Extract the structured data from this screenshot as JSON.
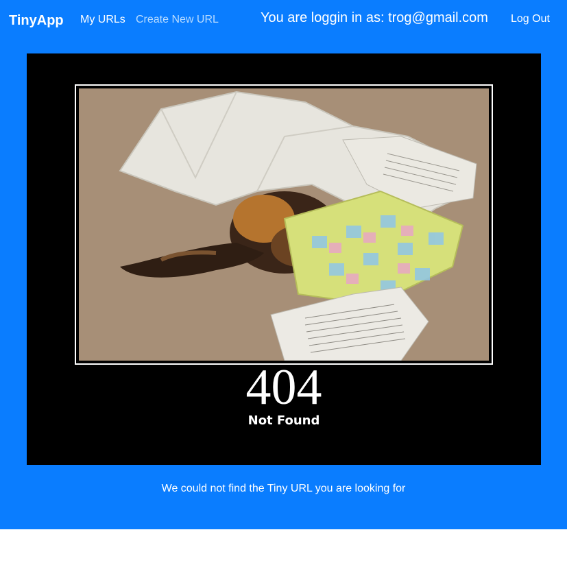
{
  "navbar": {
    "brand": "TinyApp",
    "links": [
      {
        "label": "My URLs"
      },
      {
        "label": "Create New URL"
      }
    ],
    "login_status": "You are loggin in as: trog@gmail.com",
    "logout_label": "Log Out"
  },
  "error": {
    "code": "404",
    "title": "Not Found",
    "message": "We could not find the Tiny URL you are looking for"
  },
  "colors": {
    "background": "#0a7dff",
    "poster": "#000000",
    "text": "#ffffff"
  }
}
